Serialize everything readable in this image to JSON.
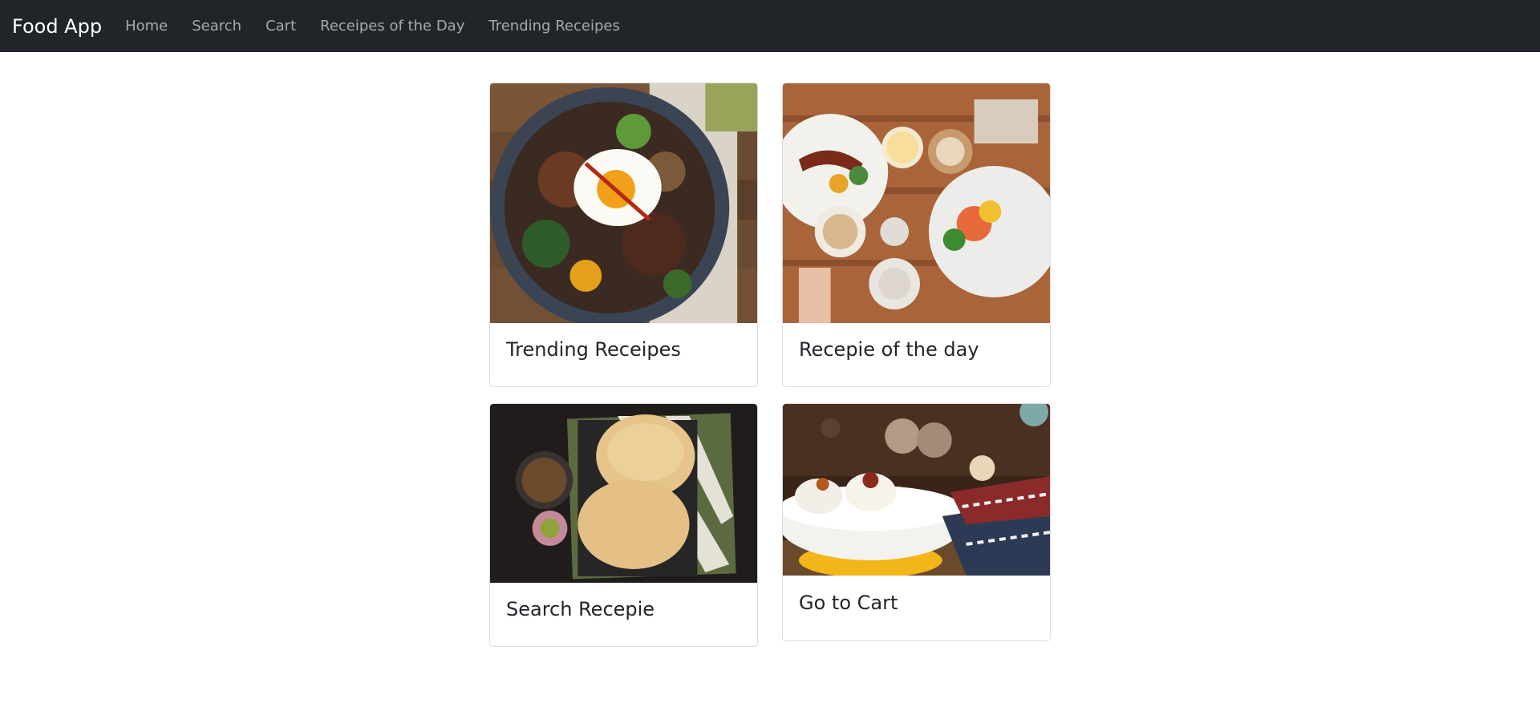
{
  "navbar": {
    "brand": "Food App",
    "links": [
      {
        "label": "Home"
      },
      {
        "label": "Search"
      },
      {
        "label": "Cart"
      },
      {
        "label": "Receipes of the Day"
      },
      {
        "label": "Trending Receipes"
      }
    ]
  },
  "cards": [
    {
      "title": "Trending Receipes",
      "image_subject": "rice bowl with fried egg and vegetables"
    },
    {
      "title": "Recepie of the day",
      "image_subject": "breakfast table with plates and coffee"
    },
    {
      "title": "Search Recepie",
      "image_subject": "chole bhature on dark plate"
    },
    {
      "title": "Go to Cart",
      "image_subject": "dahi puri bowl with bokeh background"
    }
  ],
  "colors": {
    "navbar_bg": "#212529",
    "brand_text": "#ffffff",
    "nav_link_text": "rgba(255,255,255,0.6)",
    "card_border": "rgba(0,0,0,0.14)",
    "title_text": "#212529"
  }
}
